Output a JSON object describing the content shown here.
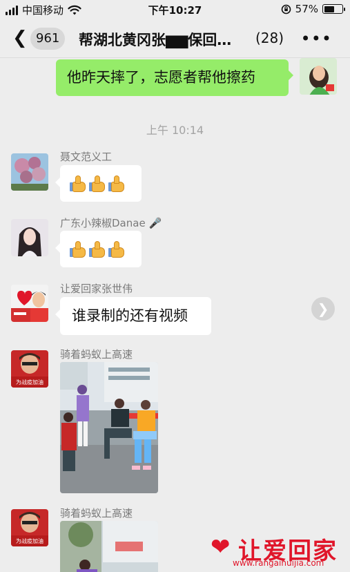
{
  "status_bar": {
    "carrier": "中国移动",
    "time": "下午10:27",
    "battery": "57%",
    "battery_level": 0.57
  },
  "nav": {
    "back_icon": "chevron-left",
    "unread_count": "961",
    "title": "帮湖北黄冈张▆▆保回…",
    "member_count": "(28)",
    "more_icon": "ellipsis"
  },
  "messages": {
    "top_outgoing": {
      "text": "他昨天摔了，志愿者帮他擦药"
    },
    "timestamp": "上午 10:14",
    "msg1": {
      "sender": "聂文范义工",
      "content": "thumbs-up x3"
    },
    "msg2": {
      "sender": "广东小辣椒Danae 🎤",
      "content": "thumbs-up x3"
    },
    "msg3": {
      "sender": "让爱回家张世伟",
      "text": "谁录制的还有视频"
    },
    "msg4": {
      "sender": "骑着蚂蚁上高速",
      "content": "street-photo"
    },
    "msg5": {
      "sender": "骑着蚂蚁上高速",
      "content": "street-photo"
    },
    "avatar_caption": "为战疫加油"
  },
  "watermark": {
    "text": "让爱回家",
    "url": "www.rangaihuijia.com"
  },
  "colors": {
    "background": "#ededed",
    "outgoing_bubble": "#95ec69",
    "incoming_bubble": "#ffffff",
    "watermark": "#e0162a"
  }
}
